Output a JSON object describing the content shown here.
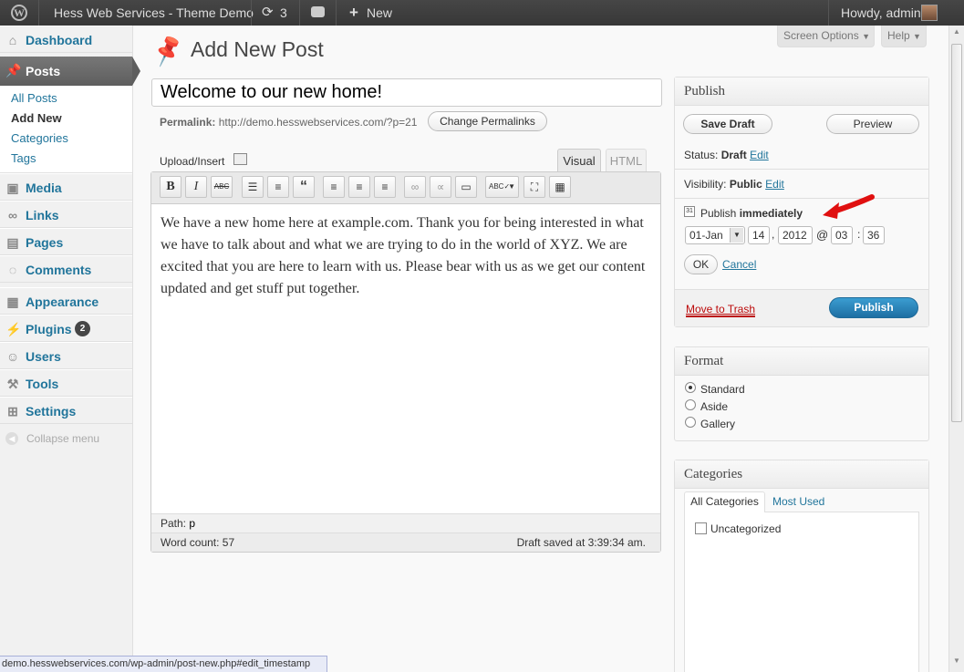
{
  "adminbar": {
    "site_name": "Hess Web Services - Theme Demo",
    "updates_count": "3",
    "new_label": "New",
    "howdy": "Howdy, admin"
  },
  "sidebar": {
    "dashboard": "Dashboard",
    "posts": "Posts",
    "posts_sub": [
      "All Posts",
      "Add New",
      "Categories",
      "Tags"
    ],
    "media": "Media",
    "links": "Links",
    "pages": "Pages",
    "comments": "Comments",
    "appearance": "Appearance",
    "plugins": "Plugins",
    "plugins_badge": "2",
    "users": "Users",
    "tools": "Tools",
    "settings": "Settings",
    "collapse": "Collapse menu"
  },
  "screen_options": "Screen Options",
  "help": "Help",
  "page_title": "Add New Post",
  "post_title": "Welcome to our new home!",
  "permalink": {
    "label": "Permalink:",
    "url": "http://demo.hesswebservices.com/?p=21",
    "change_button": "Change Permalinks"
  },
  "editor": {
    "upload_insert": "Upload/Insert",
    "tab_visual": "Visual",
    "tab_html": "HTML",
    "content": "We have a new home here at example.com. Thank you for being interested in what we have to talk about and what we are trying to do in the world of XYZ. We are excited that you are here to learn with us. Please bear with us as we get our content updated and get stuff put together.",
    "path_label": "Path:",
    "path_value": "p",
    "word_count": "Word count: 57",
    "draft_saved": "Draft saved at 3:39:34 am."
  },
  "publish": {
    "title": "Publish",
    "save_draft": "Save Draft",
    "preview": "Preview",
    "status_label": "Status:",
    "status_value": "Draft",
    "visibility_label": "Visibility:",
    "visibility_value": "Public",
    "edit": "Edit",
    "publish_label": "Publish",
    "publish_when": "immediately",
    "month": "01-Jan",
    "day": "14",
    "year": "2012",
    "at": "@",
    "hour": "03",
    "colon": ":",
    "minute": "36",
    "ok": "OK",
    "cancel": "Cancel",
    "trash": "Move to Trash",
    "publish_button": "Publish"
  },
  "format": {
    "title": "Format",
    "options": [
      "Standard",
      "Aside",
      "Gallery"
    ],
    "selected": "Standard"
  },
  "categories": {
    "title": "Categories",
    "tab_all": "All Categories",
    "tab_most_used": "Most Used",
    "items": [
      "Uncategorized"
    ]
  },
  "status_url": "demo.hesswebservices.com/wp-admin/post-new.php#edit_timestamp",
  "colors": {
    "accent": "#21759b",
    "publish_button": "#2a8bc4",
    "trash": "#bc0b0b",
    "arrow": "#e01010"
  }
}
